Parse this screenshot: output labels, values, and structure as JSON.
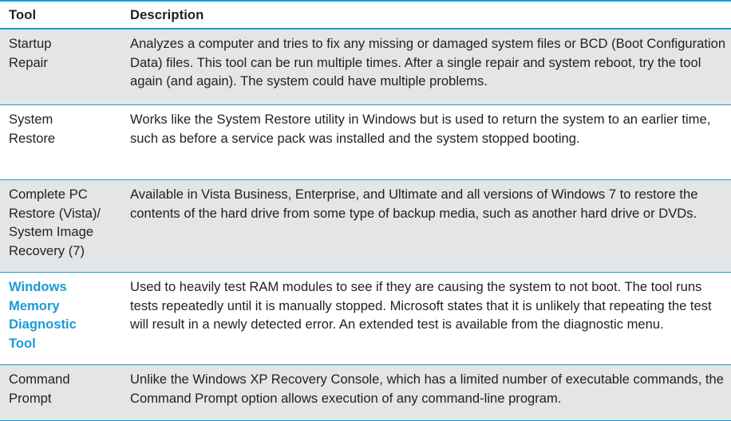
{
  "table": {
    "headers": {
      "tool": "Tool",
      "description": "Description"
    },
    "rows": [
      {
        "tool": "Startup\nRepair",
        "description": "Analyzes a computer and tries to fix any missing or damaged system files or BCD (Boot Configuration Data) files. This tool can be run multiple times. After a single repair and system reboot, try the tool again (and again). The system could have multiple problems.",
        "shaded": true,
        "highlight": false
      },
      {
        "tool": "System\nRestore",
        "description": "Works like the System Restore utility in Windows but is used to return the system to an earlier time, such as before a service pack was installed and the system stopped booting.",
        "shaded": false,
        "highlight": false
      },
      {
        "tool": "Complete PC\nRestore (Vista)/\nSystem Image\nRecovery (7)",
        "description": "Available in Vista Business, Enterprise, and Ultimate and all versions of Windows 7 to restore the contents of the hard drive from some type of backup media, such as another hard drive or DVDs.",
        "shaded": true,
        "highlight": false
      },
      {
        "tool": "Windows\nMemory\nDiagnostic\nTool",
        "description": "Used to heavily test RAM modules to see if they are causing the system to not boot. The tool runs tests repeatedly until it is manually stopped. Microsoft states that it is unlikely that repeating the test will result in a newly detected error. An extended test is available from the diagnostic menu.",
        "shaded": false,
        "highlight": true,
        "highlight_color": "#1a9ad6"
      },
      {
        "tool": "Command\nPrompt",
        "description": "Unlike the Windows XP Recovery Console, which has a limited number of executable commands, the Command Prompt option allows execution of any command-line program.",
        "shaded": true,
        "highlight": false
      }
    ]
  },
  "colors": {
    "rule": "#1a9ad6",
    "shade": "#e4e5e6",
    "text": "#231f20",
    "accent": "#1a9ad6"
  }
}
